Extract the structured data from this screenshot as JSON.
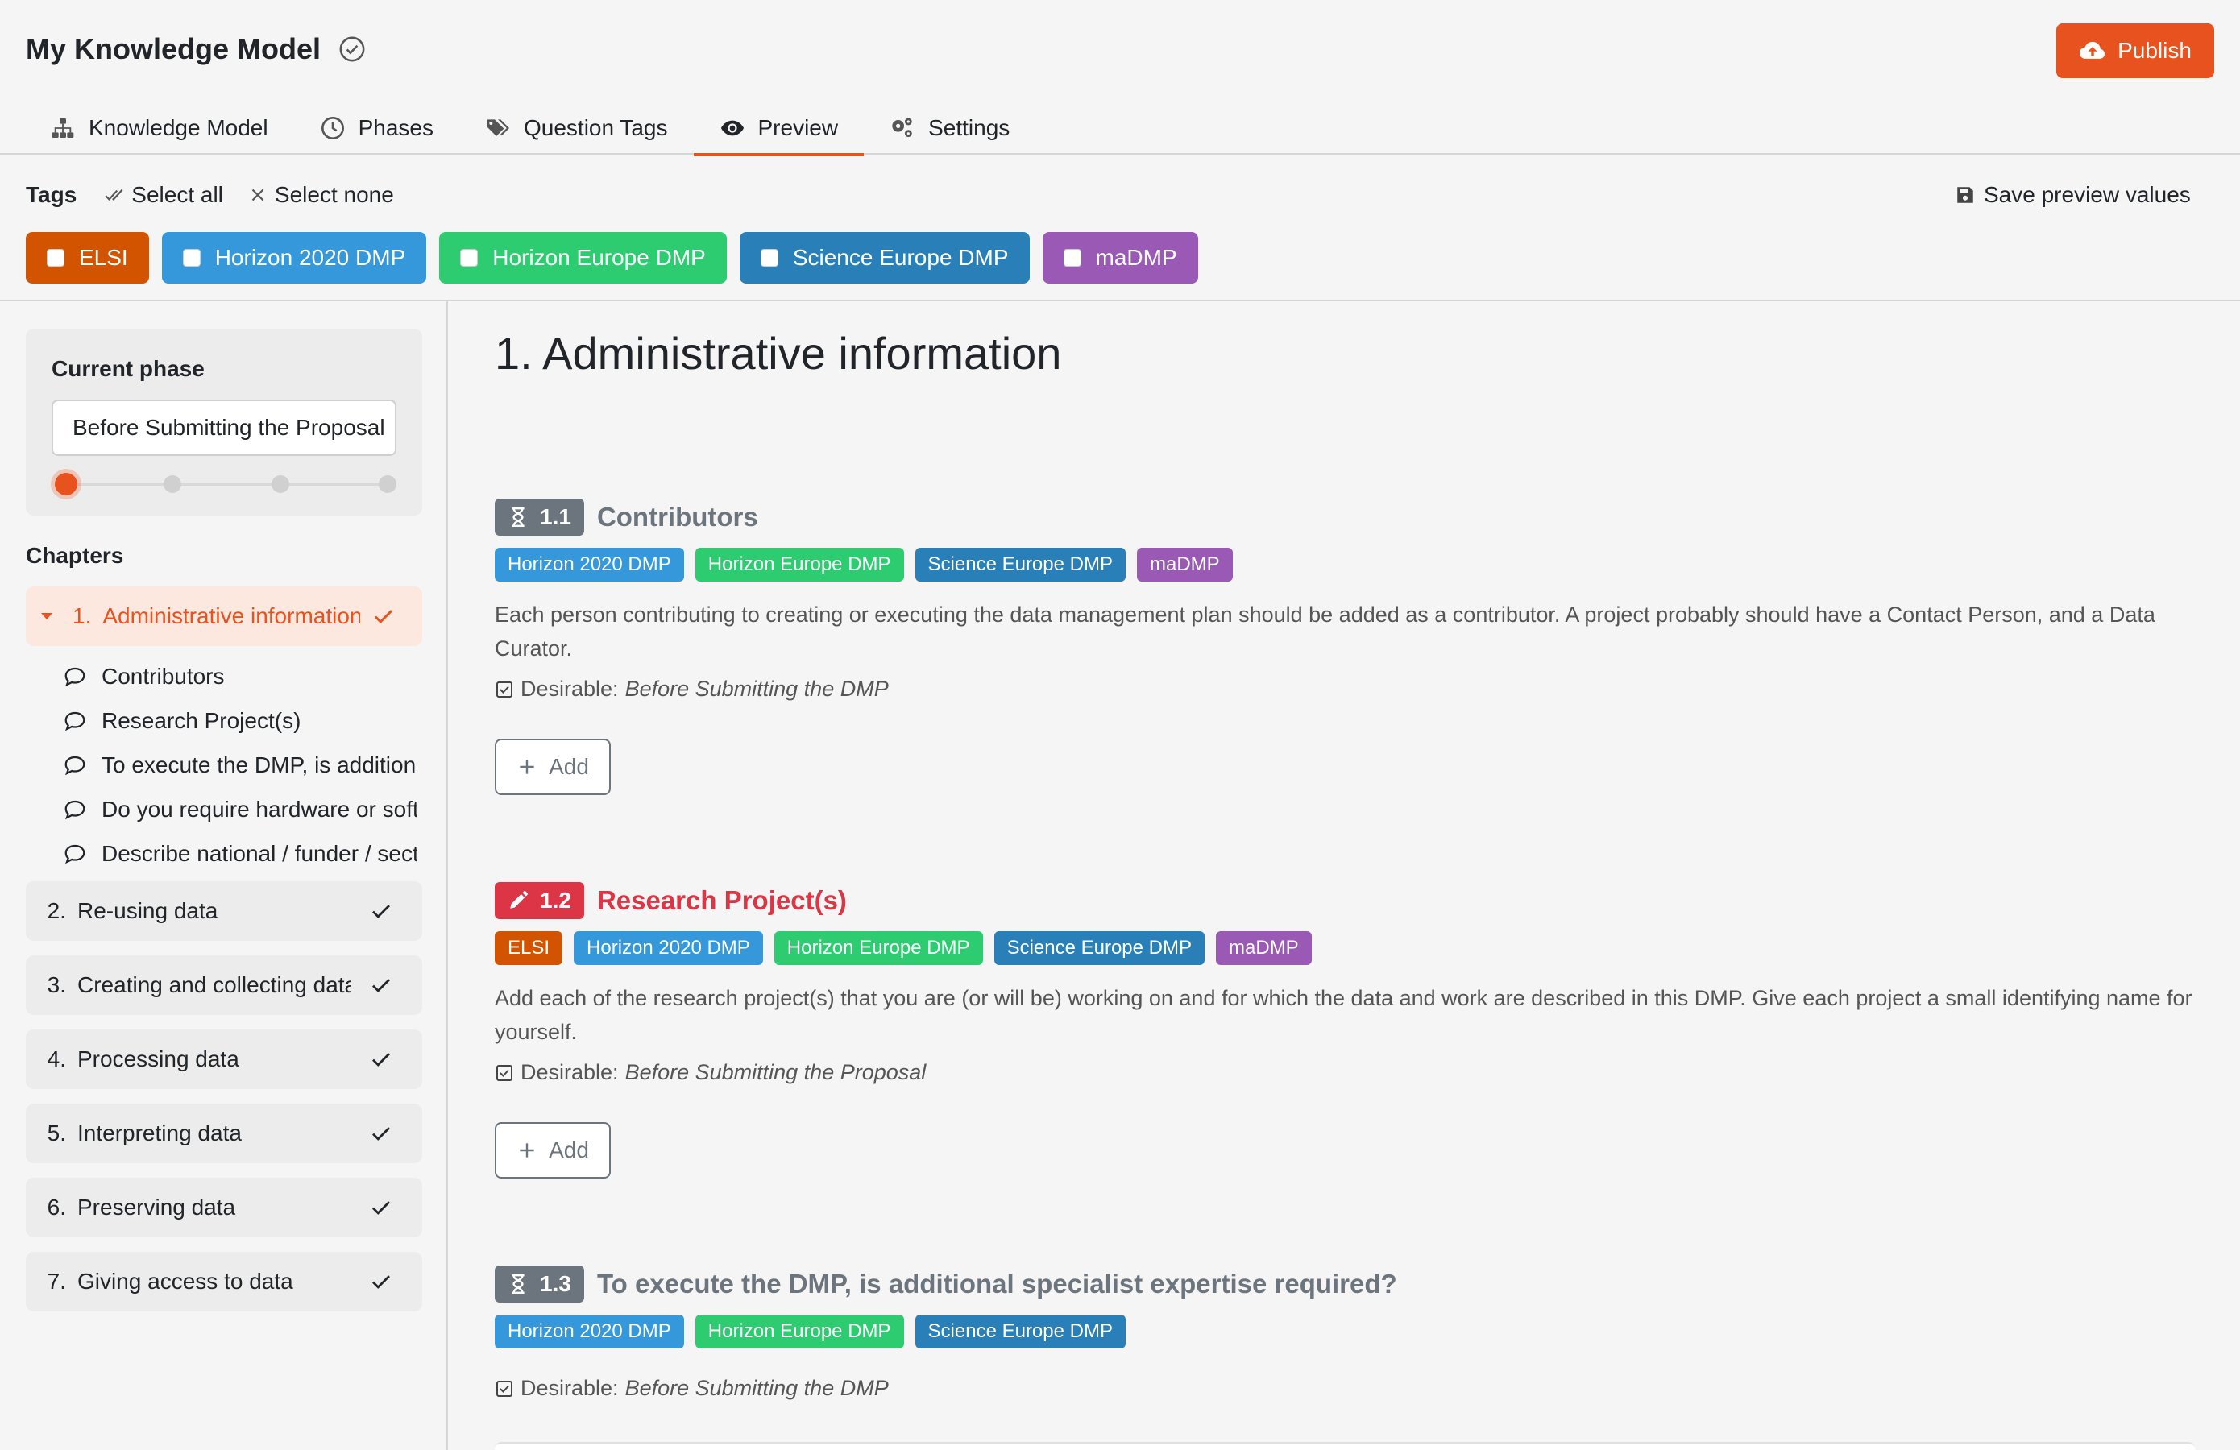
{
  "header": {
    "title": "My Knowledge Model",
    "publish_label": "Publish",
    "tabs": [
      {
        "label": "Knowledge Model",
        "icon": "sitemap-icon"
      },
      {
        "label": "Phases",
        "icon": "clock-icon"
      },
      {
        "label": "Question Tags",
        "icon": "tags-icon"
      },
      {
        "label": "Preview",
        "icon": "eye-icon",
        "active": true
      },
      {
        "label": "Settings",
        "icon": "gears-icon"
      }
    ]
  },
  "tagsbar": {
    "label": "Tags",
    "select_all": "Select all",
    "select_none": "Select none",
    "save_preview": "Save preview values",
    "tags": [
      {
        "label": "ELSI",
        "color": "#d35400"
      },
      {
        "label": "Horizon 2020 DMP",
        "color": "#3498db"
      },
      {
        "label": "Horizon Europe DMP",
        "color": "#2ecc71"
      },
      {
        "label": "Science Europe DMP",
        "color": "#2980b9"
      },
      {
        "label": "maDMP",
        "color": "#9b59b6"
      }
    ]
  },
  "sidebar": {
    "phase_heading": "Current phase",
    "phase_value": "Before Submitting the Proposal",
    "phase_level": 0,
    "phase_steps": 4,
    "chapters_heading": "Chapters",
    "active_chapter": {
      "num": "1.",
      "title": "Administrative information"
    },
    "questions": [
      "Contributors",
      "Research Project(s)",
      "To execute the DMP, is additional specialist expertise required?",
      "Do you require hardware or software which is in addition to existing institutional provision?",
      "Describe national / funder / sector / departmental procedures for data management"
    ],
    "chapters": [
      {
        "num": "2.",
        "title": "Re-using data"
      },
      {
        "num": "3.",
        "title": "Creating and collecting data"
      },
      {
        "num": "4.",
        "title": "Processing data"
      },
      {
        "num": "5.",
        "title": "Interpreting data"
      },
      {
        "num": "6.",
        "title": "Preserving data"
      },
      {
        "num": "7.",
        "title": "Giving access to data"
      }
    ]
  },
  "main": {
    "chapter_title": "1. Administrative information",
    "questions": [
      {
        "number": "1.1",
        "title": "Contributors",
        "text": "Each person contributing to creating or executing the data management plan should be added as a contributor. A project probably should have a Contact Person, and a Data Curator.",
        "desirable_label": "Desirable:",
        "desirable_value": "Before Submitting the DMP",
        "add_label": "Add"
      },
      {
        "number": "1.2",
        "title": "Research Project(s)",
        "text": "Add each of the research project(s) that you are (or will be) working on and for which the data and work are described in this DMP. Give each project a small identifying name for yourself.",
        "desirable_label": "Desirable:",
        "desirable_value": "Before Submitting the Proposal",
        "add_label": "Add"
      },
      {
        "number": "1.3",
        "title": "To execute the DMP, is additional specialist expertise required?",
        "desirable_label": "Desirable:",
        "desirable_value": "Before Submitting the DMP"
      }
    ]
  },
  "colors": {
    "accent": "#e8521e",
    "neutral_badge": "#6c757d",
    "danger": "#dc3545"
  }
}
